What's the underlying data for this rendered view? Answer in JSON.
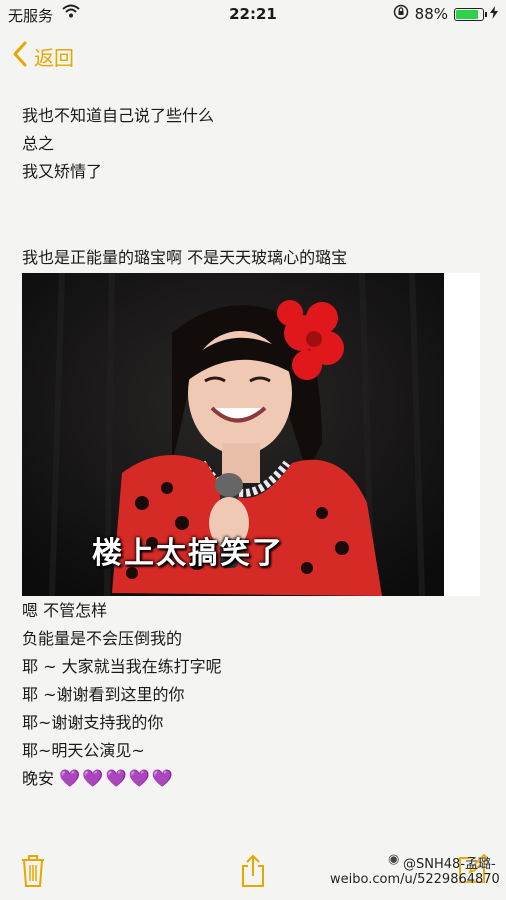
{
  "status_bar": {
    "carrier": "无服务",
    "time": "22:21",
    "battery": "88%",
    "battery_level": 0.88
  },
  "nav": {
    "back_label": "返回",
    "back_icon": "chevron-left-icon"
  },
  "note": {
    "block1": [
      "我也不知道自己说了些什么",
      "总之",
      "我又矫情了"
    ],
    "block2": [
      "我也是正能量的璐宝啊 不是天天玻璃心的璐宝"
    ],
    "image_caption": "楼上太搞笑了",
    "block3": [
      "嗯 不管怎样",
      "负能量是不会压倒我的",
      "耶 ~ 大家就当我在练打字呢",
      "耶 ~谢谢看到这里的你",
      "耶~谢谢支持我的你",
      "耶~明天公演见~"
    ],
    "last_line": "晚安",
    "hearts": "💜💜💜💜💜"
  },
  "toolbar": {
    "trash_icon": "trash-icon",
    "share_icon": "share-icon",
    "compose_icon": "compose-icon"
  },
  "watermark": {
    "handle": "@SNH48-孟璐-",
    "url": "weibo.com/u/5229864870"
  },
  "colors": {
    "accent": "#e6a800",
    "background": "#f4f4f2",
    "heart": "#a04ed0"
  }
}
